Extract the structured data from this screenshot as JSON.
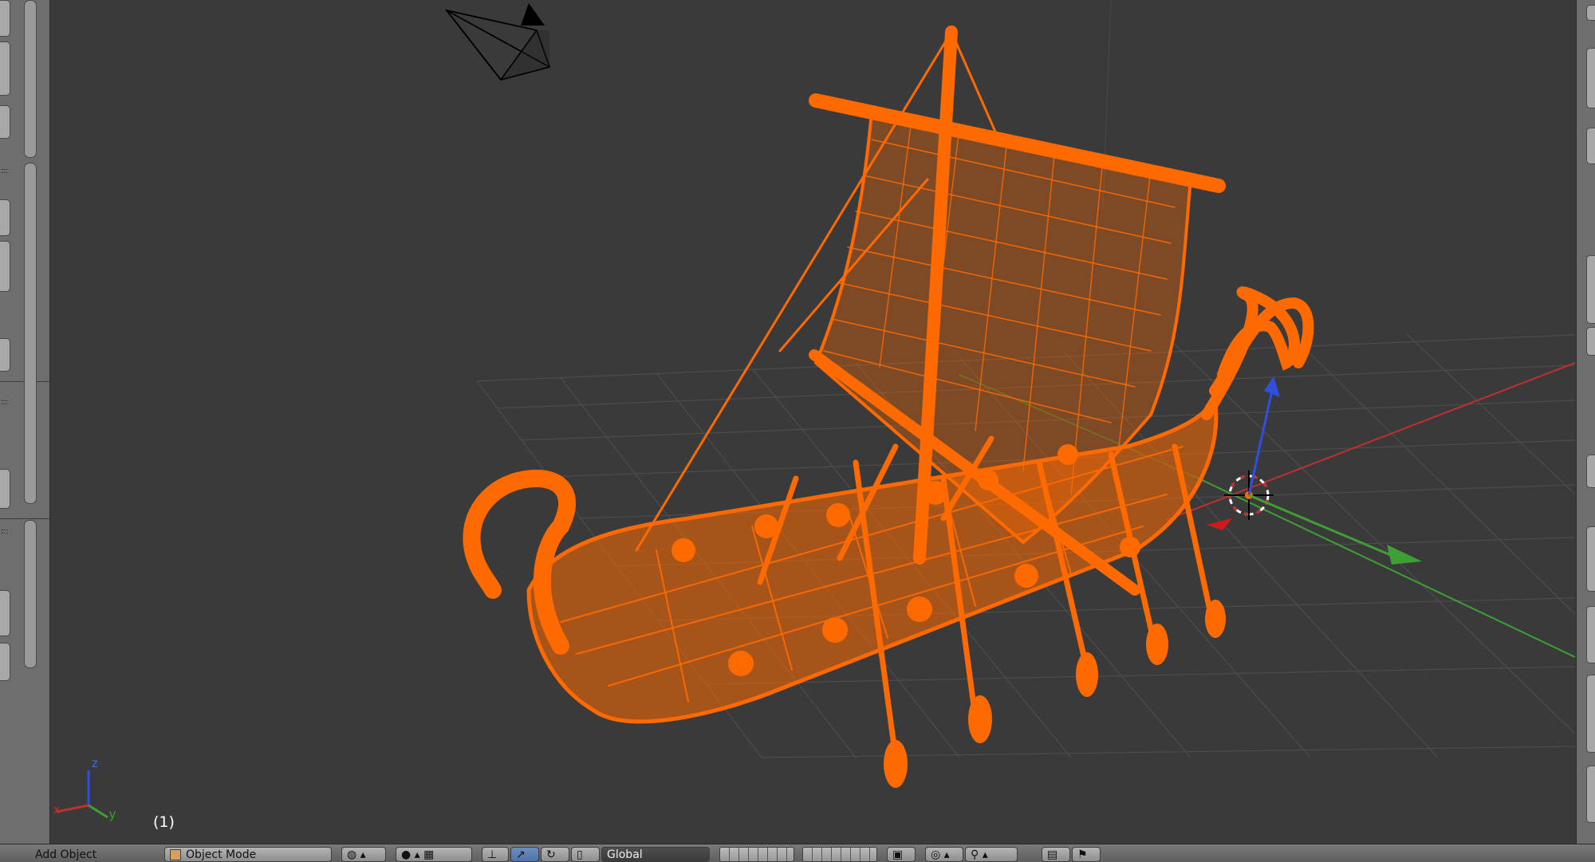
{
  "viewport": {
    "frame_label": "(1)",
    "axis_labels": {
      "x": "x",
      "y": "y",
      "z": "z"
    },
    "colors": {
      "background": "#3a3a3a",
      "grid": "#4d4d4d",
      "selection": "#ff6a00",
      "x_axis": "#c0302e",
      "y_axis": "#3ea034",
      "z_axis": "#2f4fe0",
      "camera": "#000000"
    }
  },
  "header": {
    "menu_text": "Add  Object",
    "mode_label": "Object Mode",
    "pivot_label": "Global",
    "icons": [
      "mesh-cube-icon",
      "viewport-shading-icon",
      "pivot-icon",
      "manipulator-icon",
      "translate-icon",
      "rotate-icon",
      "scale-icon",
      "orientation-icon",
      "layers-icon",
      "lock-icon",
      "proportional-edit-icon",
      "snap-icon",
      "render-icon",
      "render-animation-icon"
    ]
  },
  "side_panels": {
    "left_icon": "plus-icon",
    "right_icon": "plus-icon"
  }
}
